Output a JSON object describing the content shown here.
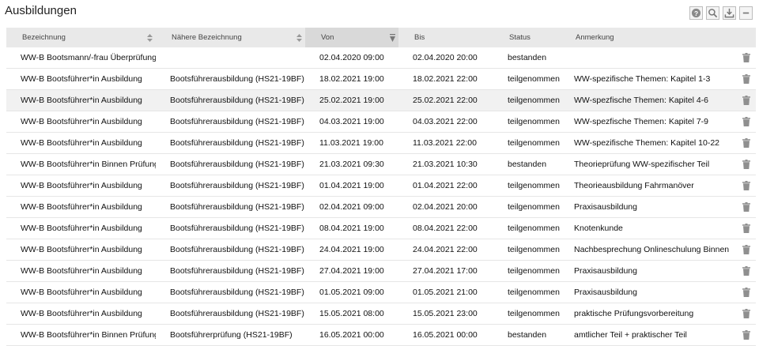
{
  "page": {
    "title": "Ausbildungen"
  },
  "toolbar": [
    "help-icon",
    "search-icon",
    "download-icon",
    "minimize-icon"
  ],
  "columns": [
    {
      "key": "bezeichnung",
      "label": "Bezeichnung",
      "sort": "none"
    },
    {
      "key": "naehere",
      "label": "Nähere Bezeichnung",
      "sort": "none"
    },
    {
      "key": "von",
      "label": "Von",
      "sort": "desc"
    },
    {
      "key": "bis",
      "label": "Bis",
      "sort": "none"
    },
    {
      "key": "status",
      "label": "Status",
      "sort": "none"
    },
    {
      "key": "anmerkung",
      "label": "Anmerkung",
      "sort": "none"
    }
  ],
  "rows": [
    [
      "WW-B Bootsmann/-frau Überprüfung",
      "",
      "02.04.2020 09:00",
      "02.04.2020 20:00",
      "bestanden",
      ""
    ],
    [
      "WW-B Bootsführer*in Ausbildung",
      "Bootsführerausbildung (HS21-19BF)",
      "18.02.2021 19:00",
      "18.02.2021 22:00",
      "teilgenommen",
      "WW-spezifische Themen: Kapitel 1-3"
    ],
    [
      "WW-B Bootsführer*in Ausbildung",
      "Bootsführerausbildung (HS21-19BF)",
      "25.02.2021 19:00",
      "25.02.2021 22:00",
      "teilgenommen",
      "WW-spezfische Themen: Kapitel 4-6"
    ],
    [
      "WW-B Bootsführer*in Ausbildung",
      "Bootsführerausbildung (HS21-19BF)",
      "04.03.2021 19:00",
      "04.03.2021 22:00",
      "teilgenommen",
      "WW-spezfische Themen: Kapitel 7-9"
    ],
    [
      "WW-B Bootsführer*in Ausbildung",
      "Bootsführerausbildung (HS21-19BF)",
      "11.03.2021 19:00",
      "11.03.2021 22:00",
      "teilgenommen",
      "WW-spezifische Themen: Kapitel 10-22"
    ],
    [
      "WW-B Bootsführer*in Binnen Prüfung",
      "Bootsführerausbildung (HS21-19BF)",
      "21.03.2021 09:30",
      "21.03.2021 10:30",
      "bestanden",
      "Theorieprüfung WW-spezifischer Teil"
    ],
    [
      "WW-B Bootsführer*in Ausbildung",
      "Bootsführerausbildung (HS21-19BF)",
      "01.04.2021 19:00",
      "01.04.2021 22:00",
      "teilgenommen",
      "Theorieausbildung Fahrmanöver"
    ],
    [
      "WW-B Bootsführer*in Ausbildung",
      "Bootsführerausbildung (HS21-19BF)",
      "02.04.2021 09:00",
      "02.04.2021 20:00",
      "teilgenommen",
      "Praxisausbildung"
    ],
    [
      "WW-B Bootsführer*in Ausbildung",
      "Bootsführerausbildung (HS21-19BF)",
      "08.04.2021 19:00",
      "08.04.2021 22:00",
      "teilgenommen",
      "Knotenkunde"
    ],
    [
      "WW-B Bootsführer*in Ausbildung",
      "Bootsführerausbildung (HS21-19BF)",
      "24.04.2021 19:00",
      "24.04.2021 22:00",
      "teilgenommen",
      "Nachbesprechung Onlineschulung Binnen"
    ],
    [
      "WW-B Bootsführer*in Ausbildung",
      "Bootsführerausbildung (HS21-19BF)",
      "27.04.2021 19:00",
      "27.04.2021 17:00",
      "teilgenommen",
      "Praxisausbildung"
    ],
    [
      "WW-B Bootsführer*in Ausbildung",
      "Bootsführerausbildung (HS21-19BF)",
      "01.05.2021 09:00",
      "01.05.2021 21:00",
      "teilgenommen",
      "Praxisausbildung"
    ],
    [
      "WW-B Bootsführer*in Ausbildung",
      "Bootsführerausbildung (HS21-19BF)",
      "15.05.2021 08:00",
      "15.05.2021 23:00",
      "teilgenommen",
      "praktische Prüfungsvorbereitung"
    ],
    [
      "WW-B Bootsführer*in Binnen Prüfung",
      "Bootsführerprüfung (HS21-19BF)",
      "16.05.2021 00:00",
      "16.05.2021 00:00",
      "bestanden",
      "amtlicher Teil + praktischer Teil"
    ]
  ],
  "highlighted_row": 2,
  "row_action_icon": "trash-icon"
}
